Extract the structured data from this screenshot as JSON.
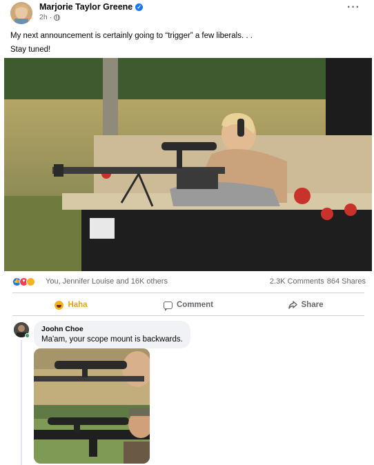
{
  "post": {
    "author": "Marjorie Taylor Greene",
    "time": "2h ·",
    "text_line1": "My next announcement is certainly going to “trigger” a few liberals. . .",
    "text_line2": "Stay tuned!",
    "more_icon": "more-horizontal-icon"
  },
  "reactions": {
    "icons": [
      "like",
      "love",
      "haha"
    ],
    "names": "You, Jennifer Louise and 16K others",
    "comments": "2.3K Comments",
    "shares": "864 Shares"
  },
  "actions": {
    "haha_label": "Haha",
    "comment_label": "Comment",
    "share_label": "Share"
  },
  "comment": {
    "name": "Joohn Choe",
    "text": "Ma'am, your scope mount is backwards."
  },
  "colors": {
    "accent": "#1877f2",
    "haha": "#e8a311",
    "text_secondary": "#65676b",
    "bubble": "#f0f2f5"
  }
}
